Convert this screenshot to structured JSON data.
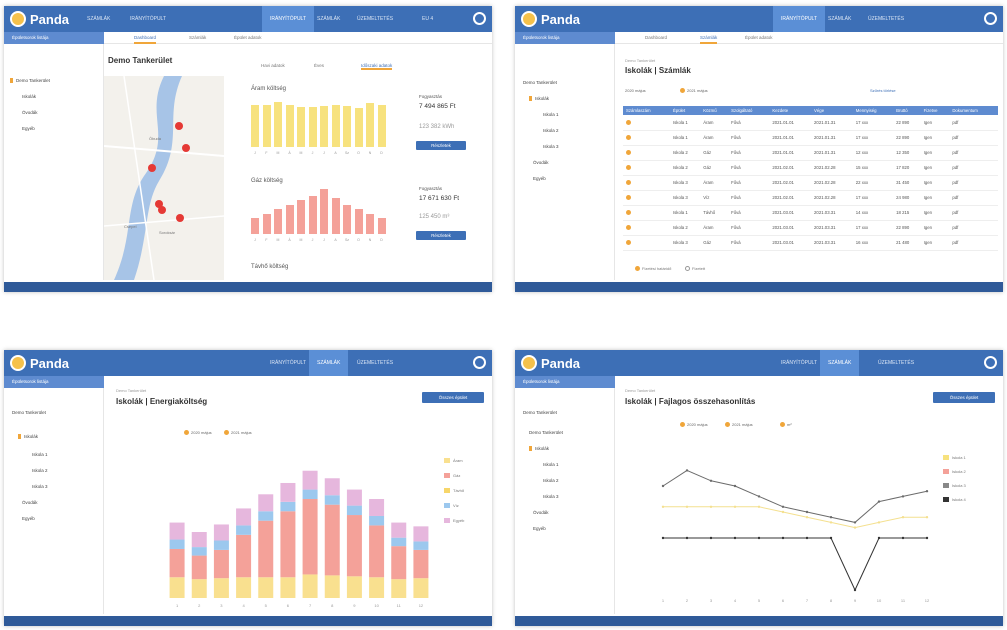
{
  "app": {
    "name": "Panda",
    "sidebar_header": "Épületsorok listája"
  },
  "s1": {
    "nav": [
      {
        "label": "IRÁNYÍTÓPULT"
      },
      {
        "label": "SZÁMLÁK"
      },
      {
        "label": "IDŐSZAKI"
      },
      {
        "label": "ELEMZÉS"
      },
      {
        "label": "ÜZEMELTETÉS"
      },
      {
        "label": "EU 4"
      }
    ],
    "tabs": [
      "Dashboard",
      "Számlák",
      "Épület adatok"
    ],
    "tree": [
      "Demo Tankerület",
      "Iskolák",
      "Óvodák",
      "Egyéb"
    ],
    "title": "Demo Tankerület",
    "chart_tabs": [
      "Havi adatok",
      "Éves",
      "Időszaki adatok"
    ],
    "map_labels": [
      "Óbuda",
      "Csepel",
      "Soroksár"
    ],
    "costs": [
      {
        "title": "Áram költség",
        "info_label": "Fogyasztás",
        "value": "7 494 865 Ft",
        "sub": "123 382 kWh",
        "button": "Részletek",
        "color": "#f7e27e"
      },
      {
        "title": "Gáz költség",
        "info_label": "Fogyasztás",
        "value": "17 671 630 Ft",
        "sub": "125 450 m³",
        "button": "Részletek",
        "color": "#f4a199"
      },
      {
        "title": "Távhő költség",
        "info_label": "Fogyasztás",
        "value": "",
        "sub": "",
        "button": "",
        "color": "#f7e27e"
      }
    ],
    "chart_data": [
      {
        "type": "bar",
        "title": "Áram költség",
        "categories": [
          "J",
          "F",
          "M",
          "Á",
          "M",
          "J",
          "J",
          "A",
          "Sz",
          "O",
          "N",
          "D"
        ],
        "values": [
          0.85,
          0.85,
          0.9,
          0.85,
          0.8,
          0.8,
          0.82,
          0.85,
          0.83,
          0.78,
          0.88,
          0.85
        ],
        "color": "#f7e27e"
      },
      {
        "type": "bar",
        "title": "Gáz költség",
        "categories": [
          "J",
          "F",
          "M",
          "Á",
          "M",
          "J",
          "J",
          "A",
          "Sz",
          "O",
          "N",
          "D"
        ],
        "values": [
          0.35,
          0.45,
          0.55,
          0.65,
          0.75,
          0.85,
          1.0,
          0.8,
          0.65,
          0.55,
          0.45,
          0.35
        ],
        "color": "#f4a199"
      }
    ]
  },
  "s2": {
    "tabs": [
      "Dashboard",
      "Számlák",
      "Épület adatok"
    ],
    "tree": [
      "Demo Tankerület",
      "Iskolák",
      "Iskola 1",
      "Iskola 2",
      "Iskola 3",
      "Óvodák",
      "Egyéb"
    ],
    "breadcrumb": "Demo Tankerület",
    "title": "Iskolák | Számlák",
    "filters": [
      "2020 május",
      "2021 május",
      "Szűrés törlése"
    ],
    "columns": [
      "Számlaszám",
      "Épület",
      "Közmű",
      "Szolgáltató",
      "Kezdete",
      "Vége",
      "Mennyiség",
      "Bruttó",
      "Fizetve",
      "Dokumentum"
    ],
    "rows": [
      [
        "Iskola 1",
        "Áram",
        "Fővá",
        "2021.01.01",
        "2021.01.31",
        "17 xxx",
        "22 890",
        "Igen",
        "pdf"
      ],
      [
        "Iskola 1",
        "Áram",
        "Fővá",
        "2021.01.01",
        "2021.01.31",
        "17 xxx",
        "22 890",
        "Igen",
        "pdf"
      ],
      [
        "Iskola 2",
        "Gáz",
        "Fővá",
        "2021.01.01",
        "2021.01.31",
        "12 xxx",
        "12 350",
        "Igen",
        "pdf"
      ],
      [
        "Iskola 2",
        "Gáz",
        "Fővá",
        "2021.02.01",
        "2021.02.28",
        "15 xxx",
        "17 820",
        "Igen",
        "pdf"
      ],
      [
        "Iskola 3",
        "Áram",
        "Fővá",
        "2021.02.01",
        "2021.02.28",
        "22 xxx",
        "31 450",
        "Igen",
        "pdf"
      ],
      [
        "Iskola 3",
        "Víz",
        "Fővá",
        "2021.02.01",
        "2021.02.28",
        "17 xxx",
        "24 980",
        "Igen",
        "pdf"
      ],
      [
        "Iskola 1",
        "Távhő",
        "Fővá",
        "2021.03.01",
        "2021.03.31",
        "14 xxx",
        "18 215",
        "Igen",
        "pdf"
      ],
      [
        "Iskola 2",
        "Áram",
        "Fővá",
        "2021.03.01",
        "2021.03.31",
        "17 xxx",
        "22 890",
        "Igen",
        "pdf"
      ],
      [
        "Iskola 3",
        "Gáz",
        "Fővá",
        "2021.03.01",
        "2021.03.31",
        "16 xxx",
        "21 480",
        "Igen",
        "pdf"
      ]
    ],
    "legend": [
      "Fizetési határidő",
      "Fizetett"
    ]
  },
  "s3": {
    "tree": [
      "Demo Tankerület",
      "Iskolák",
      "Iskola 1",
      "Iskola 2",
      "Iskola 3",
      "Óvodák",
      "Egyéb"
    ],
    "breadcrumb": "Demo Tankerület",
    "title": "Iskolák | Energiaköltség",
    "button": "Összes épület",
    "filters": [
      "2020 május",
      "2021 május"
    ],
    "legend": [
      {
        "name": "Áram",
        "color": "#f9e08f"
      },
      {
        "name": "Gáz",
        "color": "#f4a199"
      },
      {
        "name": "Távhő",
        "color": "#f7d66a"
      },
      {
        "name": "Víz",
        "color": "#9cc8ee"
      },
      {
        "name": "Egyéb",
        "color": "#e6b7dd"
      }
    ],
    "chart_data": {
      "type": "bar",
      "title": "Iskolák | Energiaköltség",
      "categories": [
        "1",
        "2",
        "3",
        "4",
        "5",
        "6",
        "7",
        "8",
        "9",
        "10",
        "11",
        "12"
      ],
      "series": [
        {
          "name": "Áram",
          "values": [
            22,
            20,
            21,
            22,
            22,
            22,
            25,
            24,
            23,
            22,
            20,
            21
          ],
          "color": "#f9e08f"
        },
        {
          "name": "Gáz",
          "values": [
            30,
            25,
            30,
            45,
            60,
            70,
            80,
            75,
            65,
            55,
            35,
            30
          ],
          "color": "#f4a199"
        },
        {
          "name": "Víz",
          "values": [
            10,
            9,
            10,
            10,
            10,
            10,
            10,
            10,
            10,
            10,
            9,
            9
          ],
          "color": "#9cc8ee"
        },
        {
          "name": "Egyéb",
          "values": [
            18,
            16,
            17,
            18,
            18,
            20,
            20,
            18,
            17,
            18,
            16,
            16
          ],
          "color": "#e6b7dd"
        }
      ]
    }
  },
  "s4": {
    "tree": [
      "Demo Tankerület",
      "Iskolák",
      "Iskola 1",
      "Iskola 2",
      "Iskola 3",
      "Óvodák",
      "Egyéb"
    ],
    "breadcrumb": "Demo Tankerület",
    "title": "Iskolák | Fajlagos összehasonlítás",
    "button": "Összes épület",
    "filters": [
      "2020 május",
      "2021 május",
      "m²"
    ],
    "legend": [
      {
        "name": "Iskola 1",
        "color": "#f7e27e"
      },
      {
        "name": "Iskola 2",
        "color": "#f4a199"
      },
      {
        "name": "Iskola 3",
        "color": "#888"
      },
      {
        "name": "Iskola 4",
        "color": "#333"
      }
    ],
    "chart_data": {
      "type": "line",
      "title": "Iskolák | Fajlagos összehasonlítás",
      "x": [
        "1",
        "2",
        "3",
        "4",
        "5",
        "6",
        "7",
        "8",
        "9",
        "10",
        "11",
        "12"
      ],
      "series": [
        {
          "name": "Iskola 1",
          "values": [
            20,
            23,
            21,
            20,
            18,
            16,
            15,
            14,
            13,
            17,
            18,
            19
          ],
          "color": "#6b6b6b"
        },
        {
          "name": "Iskola 2",
          "values": [
            16,
            16,
            16,
            16,
            16,
            15,
            14,
            13,
            12,
            13,
            14,
            14
          ],
          "color": "#f4e08f"
        },
        {
          "name": "Iskola 3",
          "values": [
            10,
            10,
            10,
            10,
            10,
            10,
            10,
            10,
            0,
            10,
            10,
            10
          ],
          "color": "#333"
        }
      ]
    }
  }
}
